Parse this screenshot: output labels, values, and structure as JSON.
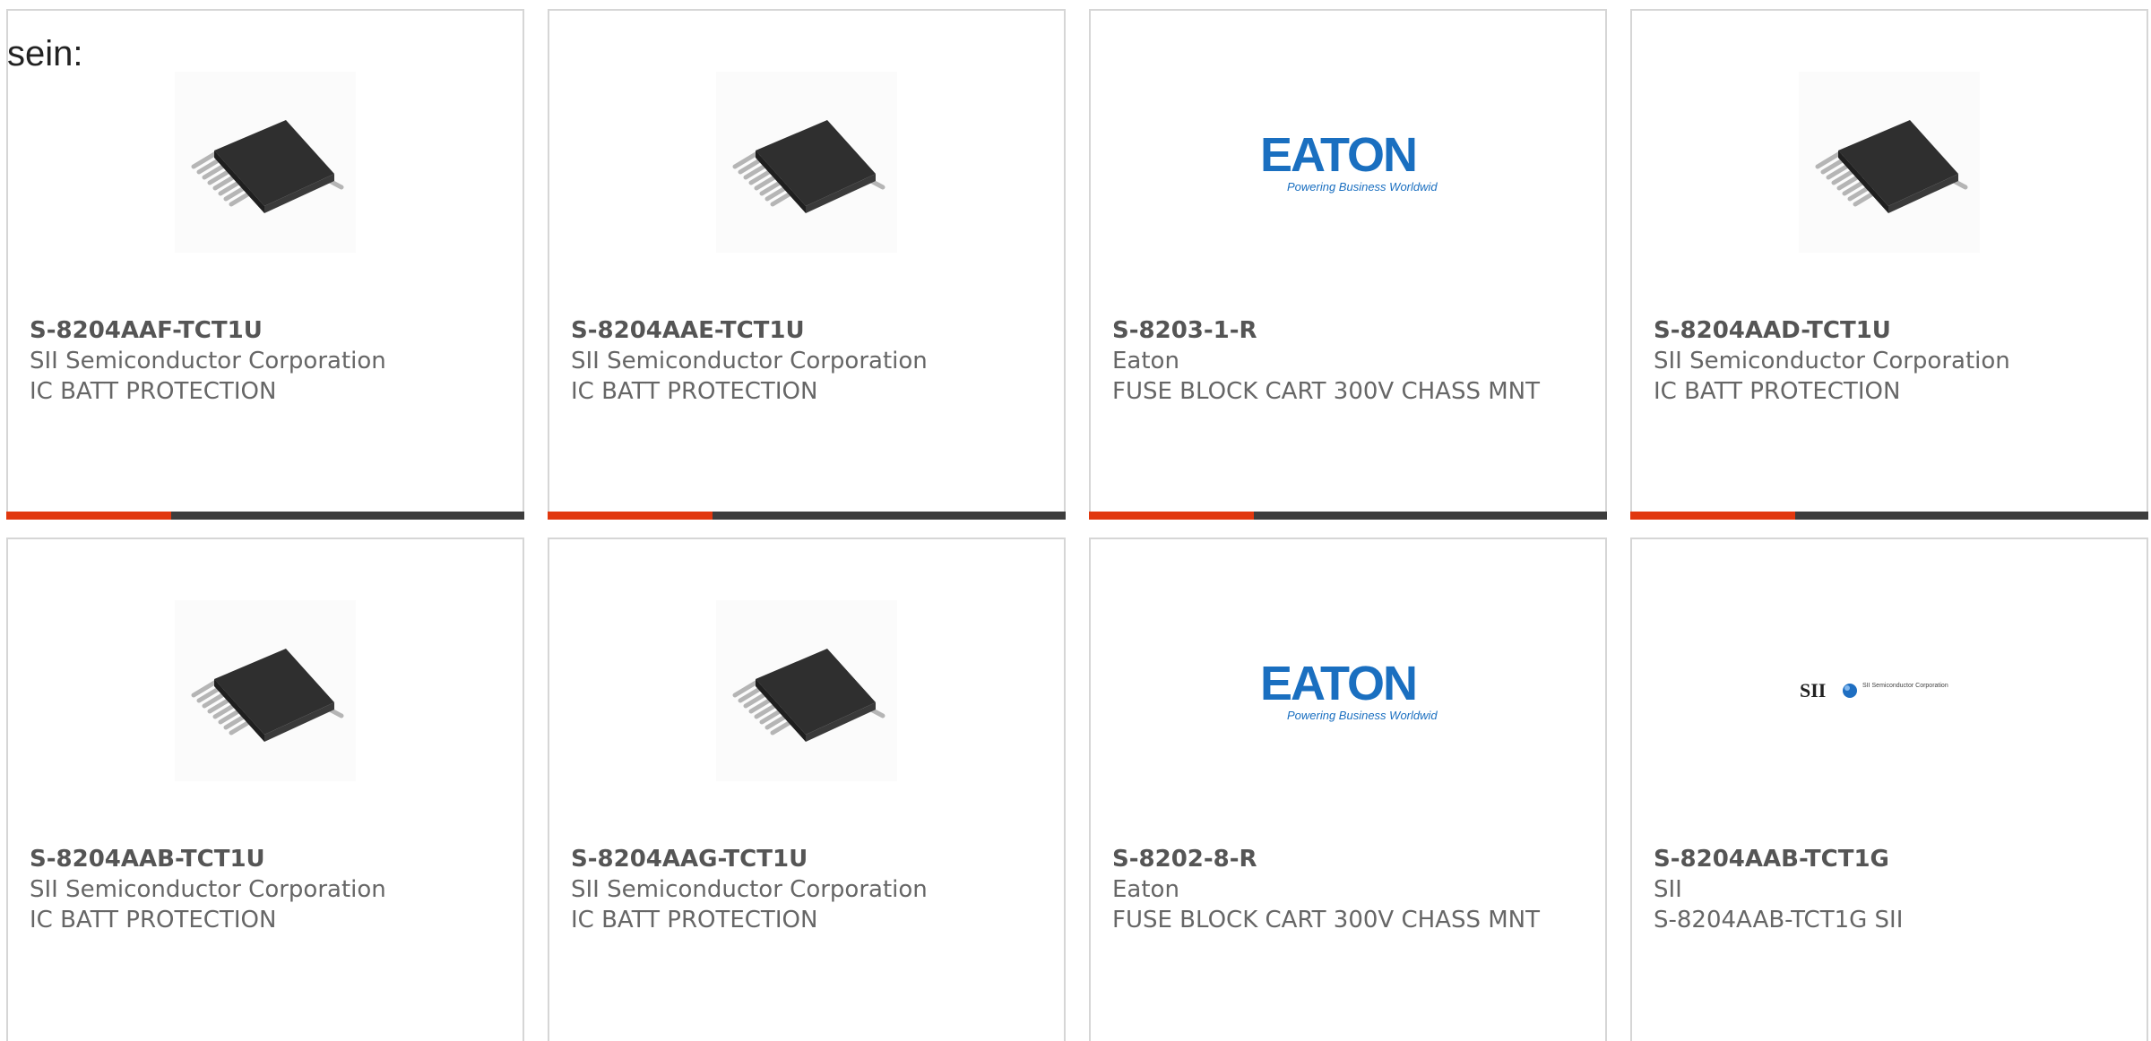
{
  "intro_text": "sein:",
  "accent_color": "#e1380f",
  "products": [
    {
      "part_number": "S-8204AAF-TCT1U",
      "manufacturer": "SII Semiconductor Corporation",
      "description": "IC BATT PROTECTION",
      "image": "ic-chip-image"
    },
    {
      "part_number": "S-8204AAE-TCT1U",
      "manufacturer": "SII Semiconductor Corporation",
      "description": "IC BATT PROTECTION",
      "image": "ic-chip-image"
    },
    {
      "part_number": "S-8203-1-R",
      "manufacturer": "Eaton",
      "description": "FUSE BLOCK CART 300V CHASS MNT",
      "image": "eaton-logo",
      "logo_text": "EATON",
      "logo_tagline": "Powering Business Worldwide"
    },
    {
      "part_number": "S-8204AAD-TCT1U",
      "manufacturer": "SII Semiconductor Corporation",
      "description": "IC BATT PROTECTION",
      "image": "ic-chip-image"
    },
    {
      "part_number": "S-8204AAB-TCT1U",
      "manufacturer": "SII Semiconductor Corporation",
      "description": "IC BATT PROTECTION",
      "image": "ic-chip-image"
    },
    {
      "part_number": "S-8204AAG-TCT1U",
      "manufacturer": "SII Semiconductor Corporation",
      "description": "IC BATT PROTECTION",
      "image": "ic-chip-image"
    },
    {
      "part_number": "S-8202-8-R",
      "manufacturer": "Eaton",
      "description": "FUSE BLOCK CART 300V CHASS MNT",
      "image": "eaton-logo",
      "logo_text": "EATON",
      "logo_tagline": "Powering Business Worldwide"
    },
    {
      "part_number": "S-8204AAB-TCT1G",
      "manufacturer": "SII",
      "description": "S-8204AAB-TCT1G SII",
      "image": "sii-logo",
      "logo_text": "SII",
      "logo_tagline": "SII Semiconductor Corporation"
    }
  ]
}
